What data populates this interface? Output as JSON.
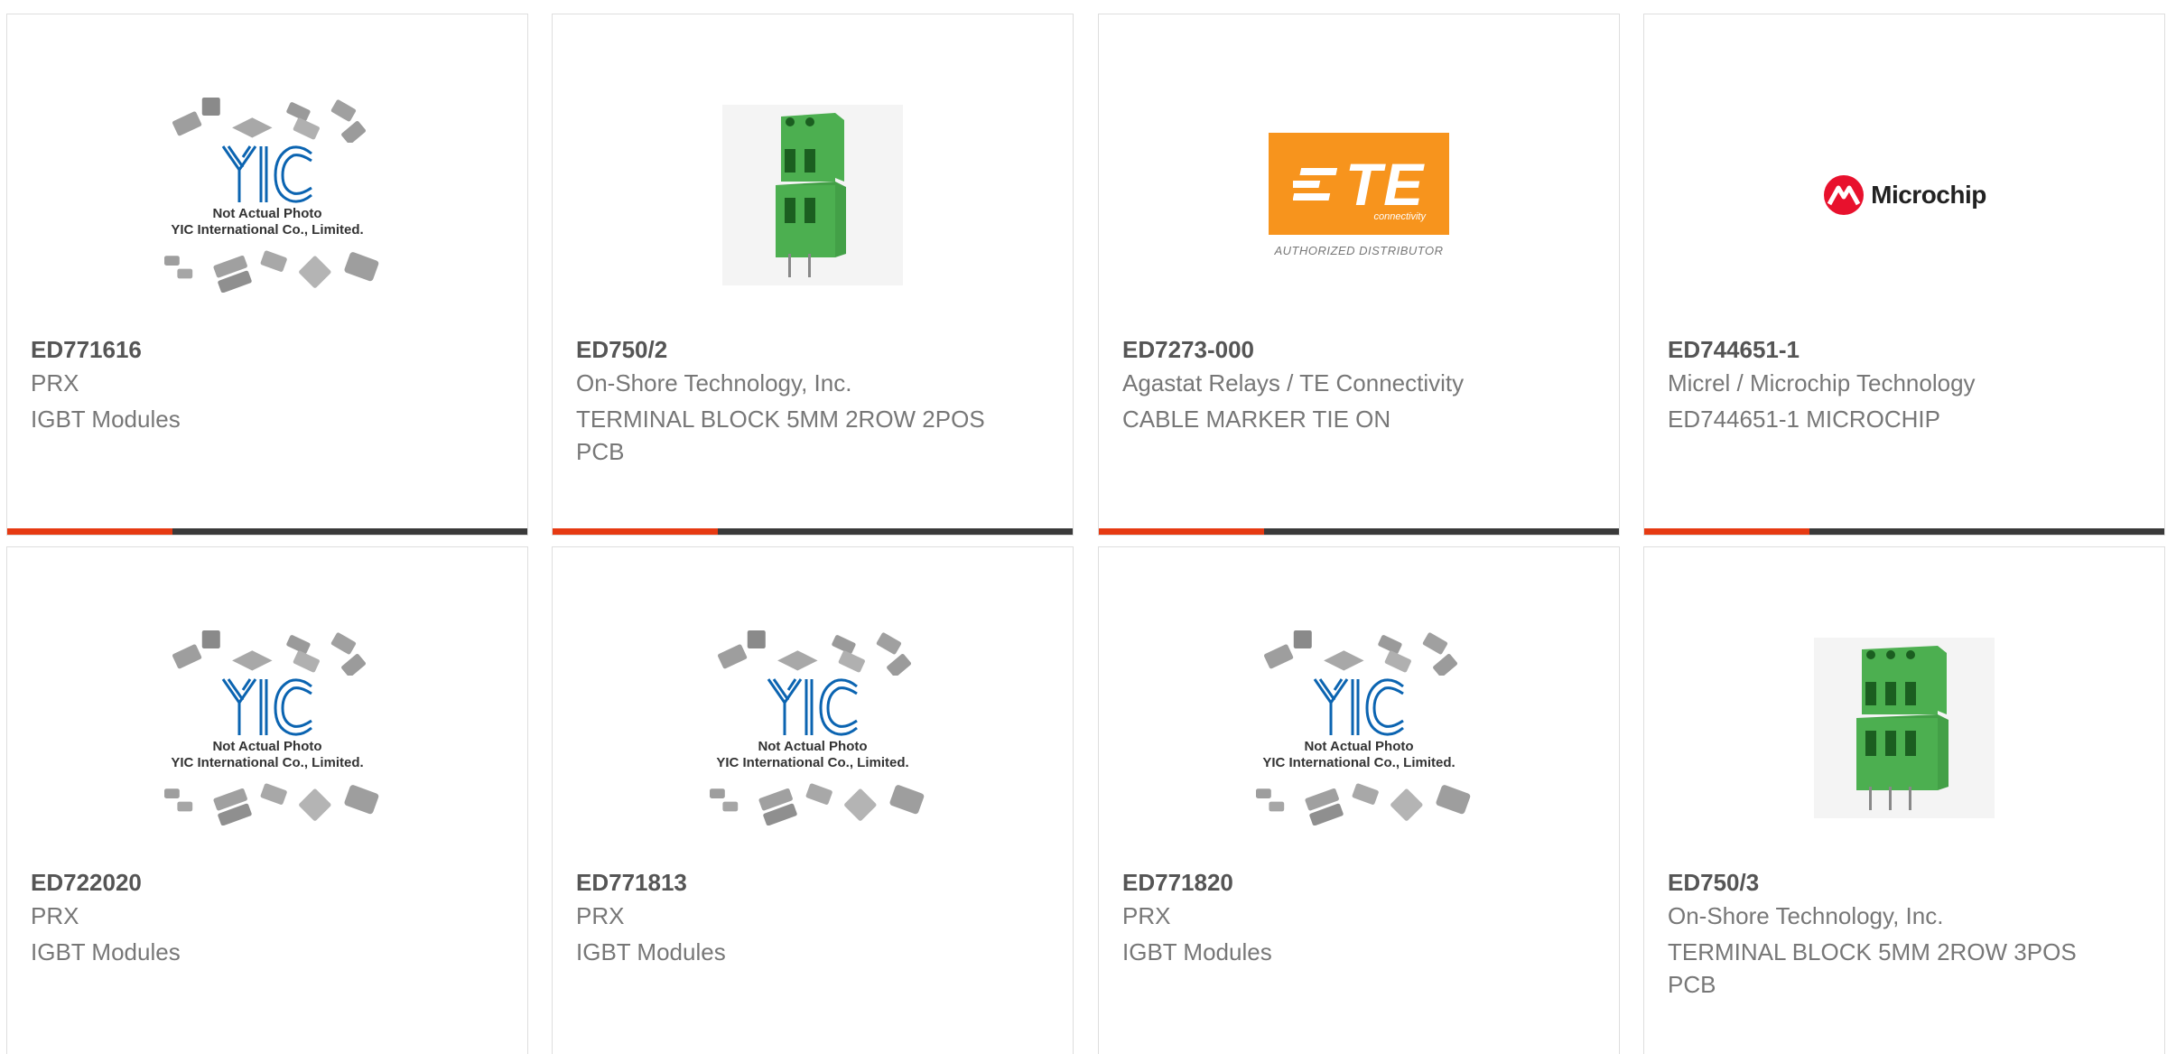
{
  "colors": {
    "accent": "#e63a12",
    "bar_dark": "#3a3a3a",
    "te_orange": "#f7941d",
    "terminal_green": "#4caf50",
    "microchip_red": "#e8112d",
    "yic_blue": "#0b64b1"
  },
  "products": [
    {
      "part_number": "ED771616",
      "manufacturer": "PRX",
      "description": "IGBT Modules",
      "image": "yic-placeholder"
    },
    {
      "part_number": "ED750/2",
      "manufacturer": "On-Shore Technology, Inc.",
      "description": "TERMINAL BLOCK 5MM 2ROW 2POS PCB",
      "image": "terminal-block-2pos"
    },
    {
      "part_number": "ED7273-000",
      "manufacturer": "Agastat Relays / TE Connectivity",
      "description": "CABLE MARKER TIE ON",
      "image": "te-logo"
    },
    {
      "part_number": "ED744651-1",
      "manufacturer": "Micrel / Microchip Technology",
      "description": "ED744651-1 MICROCHIP",
      "image": "microchip-logo"
    },
    {
      "part_number": "ED722020",
      "manufacturer": "PRX",
      "description": "IGBT Modules",
      "image": "yic-placeholder"
    },
    {
      "part_number": "ED771813",
      "manufacturer": "PRX",
      "description": "IGBT Modules",
      "image": "yic-placeholder"
    },
    {
      "part_number": "ED771820",
      "manufacturer": "PRX",
      "description": "IGBT Modules",
      "image": "yic-placeholder"
    },
    {
      "part_number": "ED750/3",
      "manufacturer": "On-Shore Technology, Inc.",
      "description": "TERMINAL BLOCK 5MM 2ROW 3POS PCB",
      "image": "terminal-block-3pos"
    }
  ],
  "placeholder": {
    "line1": "Not Actual Photo",
    "line2": "YIC International Co., Limited."
  },
  "logos": {
    "te_main": "TE",
    "te_sub": "connectivity",
    "te_caption": "AUTHORIZED DISTRIBUTOR",
    "microchip": "Microchip"
  }
}
